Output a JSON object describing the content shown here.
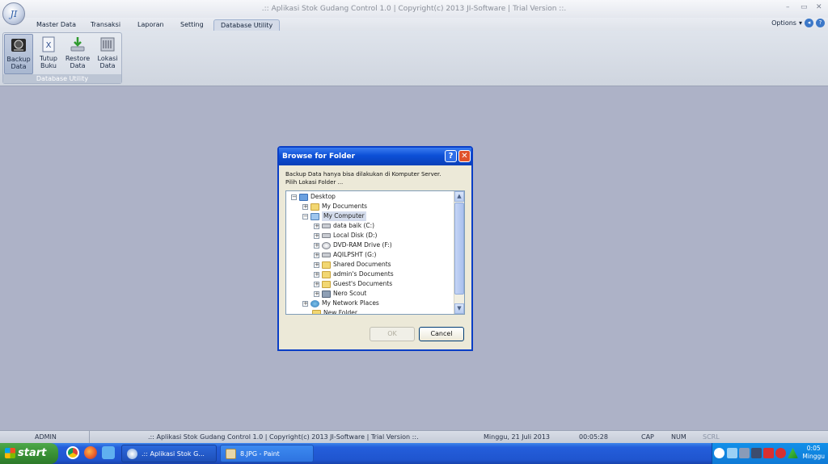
{
  "window": {
    "title": ".::  Aplikasi Stok Gudang Control 1.0   |  Copyright(c) 2013 JI-Software   |   Trial Version  ::.",
    "orb_label": "JI",
    "controls": [
      "–",
      "▭",
      "✕"
    ]
  },
  "menu": {
    "tabs": [
      "Master Data",
      "Transaksi",
      "Laporan",
      "Setting",
      "Database Utility"
    ],
    "active_tab": "Database Utility",
    "options_label": "Options",
    "options_arrow": "▾"
  },
  "ribbon": {
    "group_label": "Database Utility",
    "buttons": [
      {
        "line1": "Backup",
        "line2": "Data",
        "icon": "backup-disk-icon"
      },
      {
        "line1": "Tutup",
        "line2": "Buku",
        "icon": "close-book-icon"
      },
      {
        "line1": "Restore",
        "line2": "Data",
        "icon": "restore-download-icon"
      },
      {
        "line1": "Lokasi",
        "line2": "Data",
        "icon": "folder-location-icon"
      }
    ]
  },
  "dialog": {
    "title": "Browse for Folder",
    "message_line1": "Backup Data hanya bisa dilakukan di Komputer Server.",
    "message_line2": "Pilih Lokasi Folder ...",
    "tree": [
      {
        "label": "Desktop",
        "toggle": "−",
        "icon": "desktop-icon"
      },
      {
        "label": "My Documents",
        "toggle": "+",
        "icon": "folder-icon"
      },
      {
        "label": "My Computer",
        "toggle": "−",
        "icon": "computer-icon",
        "selected": true
      },
      {
        "label": "data baik (C:)",
        "toggle": "+",
        "icon": "drive-icon"
      },
      {
        "label": "Local Disk (D:)",
        "toggle": "+",
        "icon": "drive-icon"
      },
      {
        "label": "DVD-RAM Drive (F:)",
        "toggle": "+",
        "icon": "dvd-icon"
      },
      {
        "label": "AQILPSHT (G:)",
        "toggle": "+",
        "icon": "drive-icon"
      },
      {
        "label": "Shared Documents",
        "toggle": "+",
        "icon": "folder-icon"
      },
      {
        "label": "admin's Documents",
        "toggle": "+",
        "icon": "folder-icon"
      },
      {
        "label": "Guest's Documents",
        "toggle": "+",
        "icon": "folder-icon"
      },
      {
        "label": "Nero Scout",
        "toggle": "+",
        "icon": "nero-icon"
      },
      {
        "label": "My Network Places",
        "toggle": "+",
        "icon": "network-icon"
      },
      {
        "label": "New Folder",
        "toggle": "",
        "icon": "folder-icon"
      }
    ],
    "ok_label": "OK",
    "cancel_label": "Cancel",
    "help_label": "?",
    "close_label": "✕"
  },
  "statusbar": {
    "user": "ADMIN",
    "app": ".::  Aplikasi Stok Gudang Control 1.0   |  Copyright(c) 2013 JI-Software   |   Trial Version  ::.",
    "date": "Minggu, 21 Juli 2013",
    "time": "00:05:28",
    "cap": "CAP",
    "num": "NUM",
    "scrl": "SCRL"
  },
  "taskbar": {
    "start_label": "start",
    "tasks": [
      ".::  Aplikasi Stok G...",
      "8.JPG - Paint"
    ],
    "clock_time": "0:05",
    "clock_day": "Minggu"
  }
}
